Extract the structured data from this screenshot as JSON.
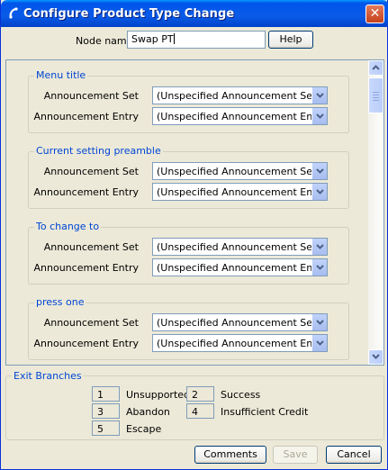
{
  "window": {
    "title": "Configure Product Type Change",
    "close_glyph": "✕"
  },
  "node": {
    "label": "Node name",
    "value": "Swap PT",
    "help_label": "Help"
  },
  "groups": [
    {
      "title": "Menu title",
      "fields": [
        {
          "label": "Announcement Set",
          "value": "(Unspecified Announcement Set)"
        },
        {
          "label": "Announcement Entry",
          "value": "(Unspecified Announcement Entry)"
        }
      ]
    },
    {
      "title": "Current setting preamble",
      "fields": [
        {
          "label": "Announcement Set",
          "value": "(Unspecified Announcement Set)"
        },
        {
          "label": "Announcement Entry",
          "value": "(Unspecified Announcement Entry)"
        }
      ]
    },
    {
      "title": "To change to",
      "fields": [
        {
          "label": "Announcement Set",
          "value": "(Unspecified Announcement Set)"
        },
        {
          "label": "Announcement Entry",
          "value": "(Unspecified Announcement Entry)"
        }
      ]
    },
    {
      "title": "press one",
      "fields": [
        {
          "label": "Announcement Set",
          "value": "(Unspecified Announcement Set)"
        },
        {
          "label": "Announcement Entry",
          "value": "(Unspecified Announcement Entry)"
        }
      ]
    }
  ],
  "exit_branches": {
    "title": "Exit Branches",
    "items": [
      {
        "num": "1",
        "label": "Unsupported"
      },
      {
        "num": "2",
        "label": "Success"
      },
      {
        "num": "3",
        "label": "Abandon"
      },
      {
        "num": "4",
        "label": "Insufficient Credit"
      },
      {
        "num": "5",
        "label": "Escape"
      }
    ]
  },
  "buttons": {
    "comments": "Comments",
    "save": "Save",
    "cancel": "Cancel"
  },
  "colors": {
    "titlebar": "#0055EA",
    "group_title": "#0046D5",
    "window_bg": "#ECE9D8"
  }
}
